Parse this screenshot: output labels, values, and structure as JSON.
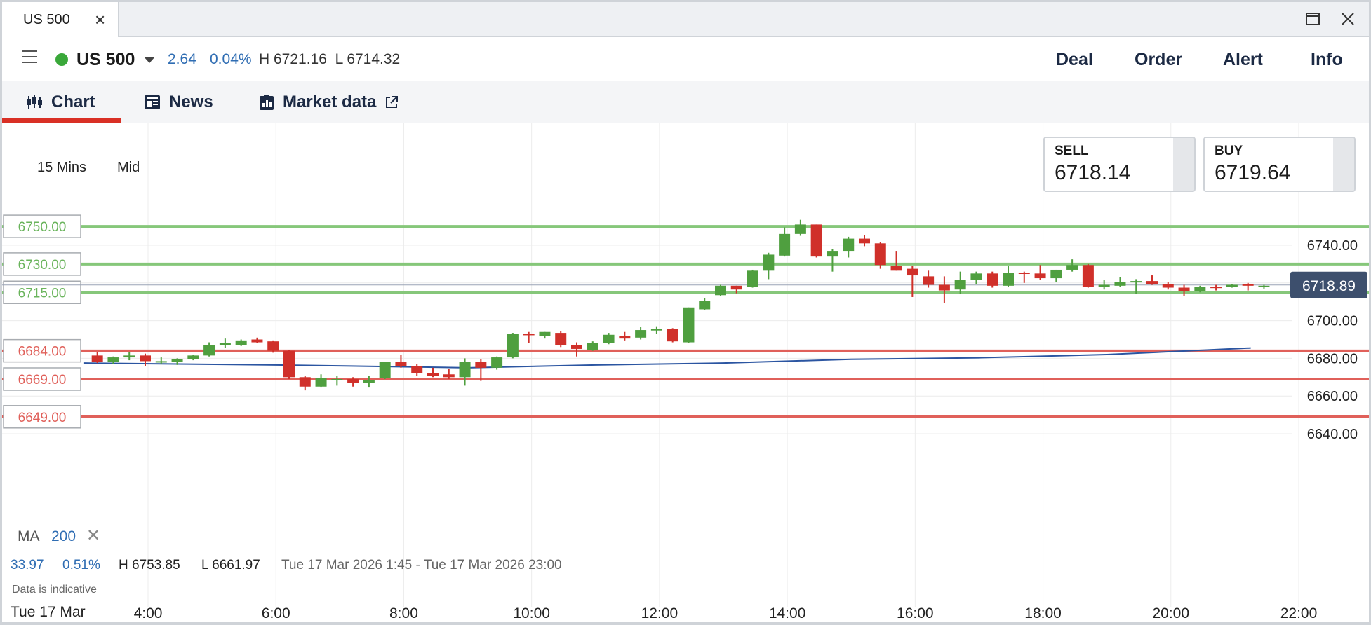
{
  "tab": {
    "title": "US 500"
  },
  "header": {
    "instrument": "US 500",
    "change": "2.64",
    "change_pct": "0.04%",
    "high_low": "H 6721.16  L 6714.32",
    "actions": [
      "Deal",
      "Order",
      "Alert",
      "Info"
    ]
  },
  "subtabs": {
    "chart": "Chart",
    "news": "News",
    "market_data": "Market data"
  },
  "chart_settings": {
    "timeframe": "15 Mins",
    "price_type": "Mid"
  },
  "quotes": {
    "sell_label": "SELL",
    "sell_price": "6718.14",
    "buy_label": "BUY",
    "buy_price": "6719.64"
  },
  "indicator": {
    "name": "MA",
    "period": "200"
  },
  "stats": {
    "change": "33.97",
    "change_pct": "0.51%",
    "high": "H 6753.85",
    "low": "L 6661.97",
    "range": "Tue 17 Mar 2026 1:45 - Tue 17 Mar 2026 23:00"
  },
  "disclaimer": "Data is indicative",
  "date_label": "Tue 17 Mar",
  "colors": {
    "up": "#4f9f3f",
    "down": "#d0302a",
    "ma": "#2b55a1",
    "green_level": "#86c77a",
    "red_level": "#e0605a",
    "current_price_bg": "#3d4f6d"
  },
  "chart_data": {
    "type": "candlestick",
    "x_ticks": [
      "4:00",
      "6:00",
      "8:00",
      "10:00",
      "12:00",
      "14:00",
      "16:00",
      "18:00",
      "20:00",
      "22:00"
    ],
    "y_ticks": [
      "6740.00",
      "6700.00",
      "6680.00",
      "6660.00",
      "6640.00"
    ],
    "ylim": [
      6635,
      6755
    ],
    "current_price": "6718.89",
    "green_levels": [
      "6750.00",
      "6730.00",
      "6715.00"
    ],
    "red_levels": [
      "6684.00",
      "6669.00",
      "6649.00"
    ],
    "candles": [
      {
        "t": "3:15",
        "o": 6681.5,
        "h": 6683.5,
        "l": 6677.5,
        "c": 6678.0
      },
      {
        "t": "3:30",
        "o": 6678.0,
        "h": 6681.0,
        "l": 6677.0,
        "c": 6680.5
      },
      {
        "t": "3:45",
        "o": 6680.5,
        "h": 6683.5,
        "l": 6679.0,
        "c": 6681.5
      },
      {
        "t": "4:00",
        "o": 6681.5,
        "h": 6682.5,
        "l": 6676.0,
        "c": 6678.5
      },
      {
        "t": "4:15",
        "o": 6678.5,
        "h": 6680.5,
        "l": 6677.0,
        "c": 6678.5
      },
      {
        "t": "4:30",
        "o": 6678.0,
        "h": 6680.0,
        "l": 6676.5,
        "c": 6679.5
      },
      {
        "t": "4:45",
        "o": 6679.5,
        "h": 6682.0,
        "l": 6679.0,
        "c": 6681.5
      },
      {
        "t": "5:00",
        "o": 6681.5,
        "h": 6688.5,
        "l": 6681.0,
        "c": 6687.0
      },
      {
        "t": "5:15",
        "o": 6687.0,
        "h": 6690.5,
        "l": 6685.5,
        "c": 6688.0
      },
      {
        "t": "5:30",
        "o": 6687.0,
        "h": 6690.0,
        "l": 6686.5,
        "c": 6689.5
      },
      {
        "t": "5:45",
        "o": 6690.0,
        "h": 6691.0,
        "l": 6688.0,
        "c": 6688.5
      },
      {
        "t": "6:00",
        "o": 6689.0,
        "h": 6689.5,
        "l": 6683.0,
        "c": 6684.0
      },
      {
        "t": "6:15",
        "o": 6684.0,
        "h": 6684.5,
        "l": 6669.0,
        "c": 6670.0
      },
      {
        "t": "6:30",
        "o": 6670.0,
        "h": 6670.5,
        "l": 6663.0,
        "c": 6665.0
      },
      {
        "t": "6:45",
        "o": 6665.0,
        "h": 6671.5,
        "l": 6664.5,
        "c": 6669.5
      },
      {
        "t": "7:00",
        "o": 6668.5,
        "h": 6670.5,
        "l": 6665.5,
        "c": 6669.0
      },
      {
        "t": "7:15",
        "o": 6669.0,
        "h": 6670.0,
        "l": 6665.0,
        "c": 6667.0
      },
      {
        "t": "7:30",
        "o": 6667.0,
        "h": 6670.5,
        "l": 6664.5,
        "c": 6668.5
      },
      {
        "t": "7:45",
        "o": 6669.5,
        "h": 6678.0,
        "l": 6669.0,
        "c": 6678.0
      },
      {
        "t": "8:00",
        "o": 6678.0,
        "h": 6682.0,
        "l": 6675.0,
        "c": 6676.0
      },
      {
        "t": "8:15",
        "o": 6676.0,
        "h": 6677.0,
        "l": 6670.5,
        "c": 6672.0
      },
      {
        "t": "8:30",
        "o": 6672.0,
        "h": 6675.0,
        "l": 6670.0,
        "c": 6670.5
      },
      {
        "t": "8:45",
        "o": 6671.5,
        "h": 6674.5,
        "l": 6669.0,
        "c": 6670.0
      },
      {
        "t": "9:00",
        "o": 6670.0,
        "h": 6680.0,
        "l": 6665.5,
        "c": 6678.0
      },
      {
        "t": "9:15",
        "o": 6678.0,
        "h": 6679.5,
        "l": 6668.0,
        "c": 6675.0
      },
      {
        "t": "9:30",
        "o": 6675.0,
        "h": 6681.0,
        "l": 6674.0,
        "c": 6680.5
      },
      {
        "t": "9:45",
        "o": 6680.5,
        "h": 6693.5,
        "l": 6680.0,
        "c": 6693.0
      },
      {
        "t": "10:00",
        "o": 6693.0,
        "h": 6694.0,
        "l": 6688.0,
        "c": 6692.5
      },
      {
        "t": "10:15",
        "o": 6692.0,
        "h": 6694.0,
        "l": 6690.5,
        "c": 6694.0
      },
      {
        "t": "10:30",
        "o": 6693.5,
        "h": 6694.5,
        "l": 6686.0,
        "c": 6687.0
      },
      {
        "t": "10:45",
        "o": 6687.0,
        "h": 6688.5,
        "l": 6681.0,
        "c": 6685.0
      },
      {
        "t": "11:00",
        "o": 6684.5,
        "h": 6689.0,
        "l": 6684.0,
        "c": 6688.0
      },
      {
        "t": "11:15",
        "o": 6688.0,
        "h": 6693.5,
        "l": 6687.5,
        "c": 6692.5
      },
      {
        "t": "11:30",
        "o": 6692.0,
        "h": 6694.0,
        "l": 6689.5,
        "c": 6690.5
      },
      {
        "t": "11:45",
        "o": 6691.0,
        "h": 6696.5,
        "l": 6690.0,
        "c": 6695.0
      },
      {
        "t": "12:00",
        "o": 6695.0,
        "h": 6697.0,
        "l": 6693.0,
        "c": 6695.5
      },
      {
        "t": "12:15",
        "o": 6695.5,
        "h": 6696.0,
        "l": 6688.5,
        "c": 6689.0
      },
      {
        "t": "12:30",
        "o": 6688.5,
        "h": 6707.0,
        "l": 6688.0,
        "c": 6707.0
      },
      {
        "t": "12:45",
        "o": 6706.0,
        "h": 6712.0,
        "l": 6705.5,
        "c": 6710.5
      },
      {
        "t": "13:00",
        "o": 6713.5,
        "h": 6719.0,
        "l": 6713.0,
        "c": 6718.5
      },
      {
        "t": "13:15",
        "o": 6718.5,
        "h": 6718.5,
        "l": 6714.5,
        "c": 6716.5
      },
      {
        "t": "13:30",
        "o": 6718.0,
        "h": 6727.0,
        "l": 6717.5,
        "c": 6726.5
      },
      {
        "t": "13:45",
        "o": 6726.5,
        "h": 6736.0,
        "l": 6722.0,
        "c": 6735.0
      },
      {
        "t": "14:00",
        "o": 6734.5,
        "h": 6749.5,
        "l": 6734.0,
        "c": 6746.0
      },
      {
        "t": "14:15",
        "o": 6746.0,
        "h": 6753.5,
        "l": 6745.0,
        "c": 6751.0
      },
      {
        "t": "14:30",
        "o": 6751.0,
        "h": 6751.0,
        "l": 6733.5,
        "c": 6734.0
      },
      {
        "t": "14:45",
        "o": 6734.0,
        "h": 6738.0,
        "l": 6726.0,
        "c": 6737.0
      },
      {
        "t": "15:00",
        "o": 6737.0,
        "h": 6744.5,
        "l": 6733.5,
        "c": 6743.5
      },
      {
        "t": "15:15",
        "o": 6743.5,
        "h": 6745.5,
        "l": 6739.5,
        "c": 6741.0
      },
      {
        "t": "15:30",
        "o": 6741.0,
        "h": 6741.5,
        "l": 6727.5,
        "c": 6729.5
      },
      {
        "t": "15:45",
        "o": 6729.0,
        "h": 6737.0,
        "l": 6726.5,
        "c": 6726.5
      },
      {
        "t": "16:00",
        "o": 6727.5,
        "h": 6729.0,
        "l": 6712.5,
        "c": 6724.0
      },
      {
        "t": "16:15",
        "o": 6723.5,
        "h": 6726.5,
        "l": 6717.5,
        "c": 6719.0
      },
      {
        "t": "16:30",
        "o": 6719.0,
        "h": 6723.5,
        "l": 6709.5,
        "c": 6716.0
      },
      {
        "t": "16:45",
        "o": 6716.5,
        "h": 6726.0,
        "l": 6714.0,
        "c": 6721.5
      },
      {
        "t": "17:00",
        "o": 6721.5,
        "h": 6726.0,
        "l": 6719.5,
        "c": 6725.0
      },
      {
        "t": "17:15",
        "o": 6725.0,
        "h": 6726.0,
        "l": 6717.5,
        "c": 6718.5
      },
      {
        "t": "17:30",
        "o": 6718.5,
        "h": 6729.0,
        "l": 6718.0,
        "c": 6725.5
      },
      {
        "t": "17:45",
        "o": 6725.5,
        "h": 6726.0,
        "l": 6720.0,
        "c": 6725.0
      },
      {
        "t": "18:00",
        "o": 6725.0,
        "h": 6729.5,
        "l": 6721.5,
        "c": 6722.5
      },
      {
        "t": "18:15",
        "o": 6722.5,
        "h": 6727.0,
        "l": 6720.5,
        "c": 6727.0
      },
      {
        "t": "18:30",
        "o": 6727.0,
        "h": 6732.5,
        "l": 6726.0,
        "c": 6729.5
      },
      {
        "t": "18:45",
        "o": 6729.5,
        "h": 6730.0,
        "l": 6717.5,
        "c": 6718.0
      },
      {
        "t": "19:00",
        "o": 6718.0,
        "h": 6721.5,
        "l": 6716.5,
        "c": 6719.0
      },
      {
        "t": "19:15",
        "o": 6718.5,
        "h": 6723.0,
        "l": 6718.0,
        "c": 6720.5
      },
      {
        "t": "19:30",
        "o": 6720.5,
        "h": 6722.0,
        "l": 6714.0,
        "c": 6721.0
      },
      {
        "t": "19:45",
        "o": 6721.0,
        "h": 6724.0,
        "l": 6719.0,
        "c": 6719.5
      },
      {
        "t": "20:00",
        "o": 6719.5,
        "h": 6720.5,
        "l": 6716.5,
        "c": 6717.5
      },
      {
        "t": "20:15",
        "o": 6717.5,
        "h": 6719.0,
        "l": 6713.0,
        "c": 6715.5
      },
      {
        "t": "20:30",
        "o": 6715.5,
        "h": 6718.5,
        "l": 6715.0,
        "c": 6718.0
      },
      {
        "t": "20:45",
        "o": 6718.0,
        "h": 6719.0,
        "l": 6716.0,
        "c": 6717.5
      },
      {
        "t": "21:00",
        "o": 6718.0,
        "h": 6719.5,
        "l": 6717.5,
        "c": 6719.0
      },
      {
        "t": "21:15",
        "o": 6719.5,
        "h": 6720.0,
        "l": 6716.0,
        "c": 6718.5
      },
      {
        "t": "21:30",
        "o": 6718.5,
        "h": 6719.0,
        "l": 6717.0,
        "c": 6718.5
      }
    ],
    "ma_series": [
      {
        "t": "3:00",
        "v": 6677.5
      },
      {
        "t": "6:00",
        "v": 6676.5
      },
      {
        "t": "9:00",
        "v": 6675.0
      },
      {
        "t": "11:00",
        "v": 6676.5
      },
      {
        "t": "13:00",
        "v": 6677.5
      },
      {
        "t": "15:00",
        "v": 6679.5
      },
      {
        "t": "17:00",
        "v": 6680.3
      },
      {
        "t": "19:00",
        "v": 6682.0
      },
      {
        "t": "21:15",
        "v": 6685.5
      }
    ]
  }
}
